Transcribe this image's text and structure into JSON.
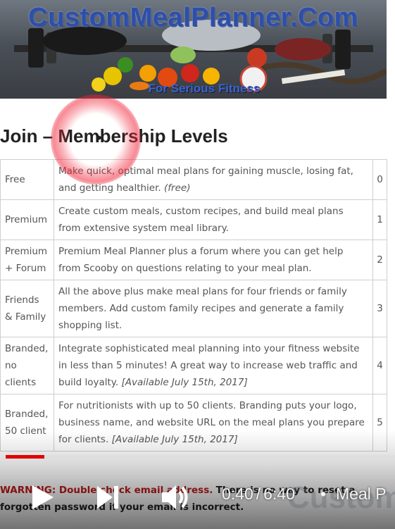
{
  "banner": {
    "title": "CustomMealPlanner.Com",
    "tagline": "For Serious Fitness"
  },
  "heading": "Join – Membership Levels",
  "levels": [
    {
      "name": "Free",
      "description": "Make quick, optimal meal plans for gaining muscle, losing fat, and getting healthier.",
      "note": "(free)",
      "number": "0"
    },
    {
      "name": "Premium",
      "description": "Create custom meals, custom recipes, and build meal plans from extensive system meal library.",
      "note": "",
      "number": "1"
    },
    {
      "name": "Premium + Forum",
      "description": "Premium Meal Planner plus a forum where you can get help from Scooby on questions relating to your meal plan.",
      "note": "",
      "number": "2"
    },
    {
      "name": "Friends & Family",
      "description": "All the above plus make meal plans for four friends or family members. Add custom family recipes and generate a family shopping list.",
      "note": "",
      "number": "3"
    },
    {
      "name": "Branded, no clients",
      "description": "Integrate sophisticated meal planning into your fitness website in less than 5 minutes! A great way to increase web traffic and build loyalty.",
      "note": "[Available July 15th, 2017]",
      "number": "4"
    },
    {
      "name": "Branded, 50 client",
      "description": "For nutritionists with up to 50 clients. Branding puts your logo, business name, and website URL on the meal plans you prepare for clients.",
      "note": "[Available July 15th, 2017]",
      "number": "5"
    }
  ],
  "warning": {
    "prefix": "WARNING: Double check email address.",
    "rest": "There is no way to reset a forgotten password if your email is incorrect."
  },
  "video": {
    "current_time": "0:40",
    "separator": "/",
    "duration": "6:40",
    "title": "Meal P",
    "watermark": "Custom",
    "progress_fraction": 0.1,
    "play_icon": "play-icon",
    "next_icon": "next-icon",
    "volume_icon": "volume-icon",
    "progress_color": "#e00000"
  }
}
